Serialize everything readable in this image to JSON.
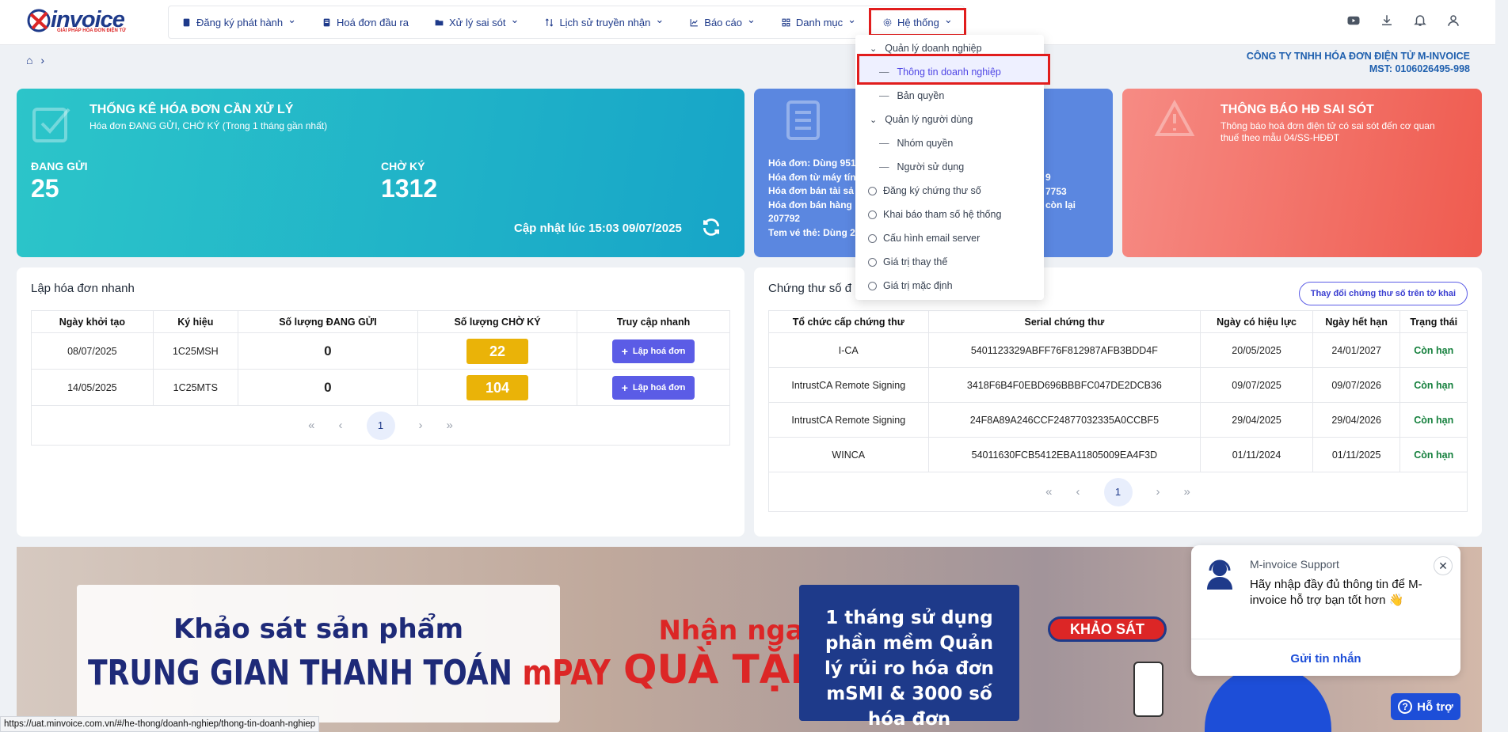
{
  "logo": {
    "text": "invoice",
    "tagline": "GIẢI PHÁP HÓA ĐƠN ĐIỆN TỬ"
  },
  "nav": [
    {
      "label": "Đăng ký phát hành",
      "icon": "document-icon",
      "chevron": true
    },
    {
      "label": "Hoá đơn đầu ra",
      "icon": "invoice-icon",
      "chevron": false
    },
    {
      "label": "Xử lý sai sót",
      "icon": "folder-icon",
      "chevron": true
    },
    {
      "label": "Lịch sử truyền nhận",
      "icon": "transfer-icon",
      "chevron": true
    },
    {
      "label": "Báo cáo",
      "icon": "chart-icon",
      "chevron": true
    },
    {
      "label": "Danh mục",
      "icon": "grid-icon",
      "chevron": true
    },
    {
      "label": "Hệ thống",
      "icon": "gear-icon",
      "chevron": true
    }
  ],
  "dropdown": [
    {
      "label": "Quản lý doanh nghiệp",
      "type": "group"
    },
    {
      "label": "Thông tin doanh nghiệp",
      "type": "sub",
      "selected": true
    },
    {
      "label": "Bản quyền",
      "type": "sub"
    },
    {
      "label": "Quản lý người dùng",
      "type": "group"
    },
    {
      "label": "Nhóm quyền",
      "type": "sub"
    },
    {
      "label": "Người sử dụng",
      "type": "sub"
    },
    {
      "label": "Đăng ký chứng thư số",
      "type": "item"
    },
    {
      "label": "Khai báo tham số hệ thống",
      "type": "item"
    },
    {
      "label": "Cấu hình email server",
      "type": "item"
    },
    {
      "label": "Giá trị thay thế",
      "type": "item"
    },
    {
      "label": "Giá trị mặc định",
      "type": "item"
    }
  ],
  "company": {
    "name": "CÔNG TY TNHH HÓA ĐƠN ĐIỆN TỬ M-INVOICE",
    "mst": "MST: 0106026495-998"
  },
  "card1": {
    "title": "THỐNG KÊ HÓA ĐƠN CẦN XỬ LÝ",
    "subtitle": "Hóa đơn ĐANG GỬI, CHỜ KÝ (Trong 1 tháng gần nhất)",
    "sending_label": "ĐANG GỬI",
    "sending_value": "25",
    "waiting_label": "CHỜ KÝ",
    "waiting_value": "1312",
    "updated": "Cập nhật lúc 15:03 09/07/2025"
  },
  "card2": {
    "l1": "Hóa đơn: Dùng 951",
    "l2": "Hóa đơn từ máy tín",
    "l3": "Hóa đơn bán tài sả",
    "l4": "Hóa đơn bán hàng",
    "l5": "207792",
    "l6": "Tem vé thẻ: Dùng 2",
    "r1": "9",
    "r2": "7753",
    "r3": "còn lại"
  },
  "card3": {
    "title": "THÔNG BÁO HĐ SAI SÓT",
    "subtitle": "Thông báo hoá đơn điện tử có sai sót đến cơ quan thuế theo mẫu 04/SS-HĐĐT"
  },
  "quick": {
    "title": "Lập hóa đơn nhanh",
    "headers": [
      "Ngày khởi tạo",
      "Ký hiệu",
      "Số lượng ĐANG GỬI",
      "Số lượng CHỜ KÝ",
      "Truy cập nhanh"
    ],
    "rows": [
      {
        "date": "08/07/2025",
        "symbol": "1C25MSH",
        "sending": "0",
        "waiting": "22",
        "action": "Lập hoá đơn"
      },
      {
        "date": "14/05/2025",
        "symbol": "1C25MTS",
        "sending": "0",
        "waiting": "104",
        "action": "Lập hoá đơn"
      }
    ],
    "page": "1"
  },
  "cert": {
    "title": "Chứng thư số đ",
    "change_btn": "Thay đổi chứng thư số trên tờ khai",
    "headers": [
      "Tổ chức cấp chứng thư",
      "Serial chứng thư",
      "Ngày có hiệu lực",
      "Ngày hết hạn",
      "Trạng thái"
    ],
    "rows": [
      {
        "org": "I-CA",
        "serial": "5401123329ABFF76F812987AFB3BDD4F",
        "from": "20/05/2025",
        "to": "24/01/2027",
        "status": "Còn hạn"
      },
      {
        "org": "IntrustCA Remote Signing",
        "serial": "3418F6B4F0EBD696BBBFC047DE2DCB36",
        "from": "09/07/2025",
        "to": "09/07/2026",
        "status": "Còn hạn"
      },
      {
        "org": "IntrustCA Remote Signing",
        "serial": "24F8A89A246CCF24877032335A0CCBF5",
        "from": "29/04/2025",
        "to": "29/04/2026",
        "status": "Còn hạn"
      },
      {
        "org": "WINCA",
        "serial": "54011630FCB5412EBA11805009EA4F3D",
        "from": "01/11/2024",
        "to": "01/11/2025",
        "status": "Còn hạn"
      }
    ],
    "page": "1"
  },
  "banner": {
    "survey1": "Khảo sát sản phẩm",
    "survey2": "TRUNG GIAN THANH TOÁN",
    "mpay": "mPAY",
    "gift1": "Nhận ngay",
    "gift2": "QUÀ TẶNG",
    "offer": "1 tháng sử dụng phần mềm Quản lý rủi ro hóa đơn mSMI & 3000 số hóa đơn",
    "survey_btn": "KHẢO SÁT"
  },
  "chat": {
    "name": "M-invoice Support",
    "message": "Hãy nhập đầy đủ thông tin để M-invoice hỗ trợ bạn tốt hơn 👋",
    "send": "Gửi tin nhắn",
    "help": "Hỗ trợ"
  },
  "status_url": "https://uat.minvoice.com.vn/#/he-thong/doanh-nghiep/thong-tin-doanh-nghiep"
}
